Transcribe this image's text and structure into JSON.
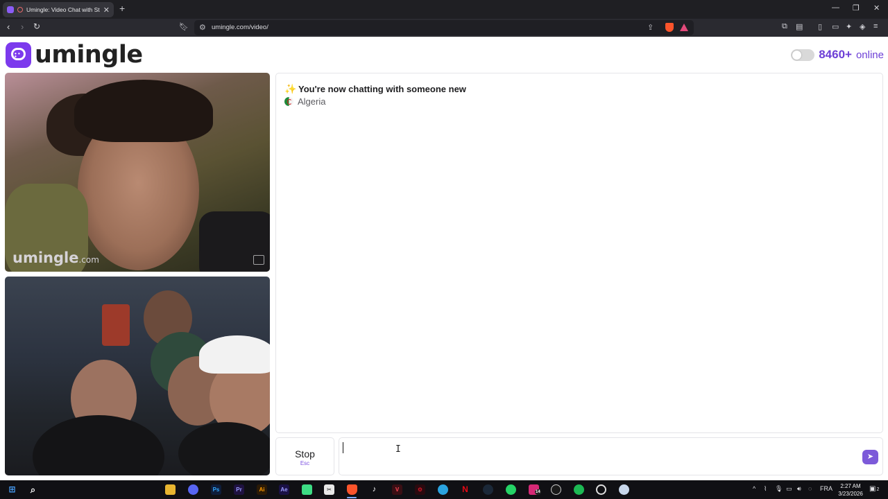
{
  "browser": {
    "tab_title": "Umingle: Video Chat with Str",
    "new_tab": "+",
    "url": "umingle.com/video/",
    "window_controls": [
      "—",
      "❐",
      "✕"
    ]
  },
  "header": {
    "logo_text": "umingle",
    "online_count": "8460+",
    "online_label": "online"
  },
  "videos": {
    "watermark_main": "umingle",
    "watermark_suffix": ".com"
  },
  "chat": {
    "system_message": "You're now chatting with someone new",
    "country": "Algeria",
    "stop_label": "Stop",
    "stop_key": "Esc",
    "input_value": ""
  },
  "taskbar": {
    "language": "FRA",
    "time": "2:27 AM",
    "date": "3/23/2026",
    "notification_count": "2",
    "badge_count": "14",
    "apps": [
      "file-explorer",
      "discord",
      "photoshop",
      "premiere",
      "illustrator",
      "after-effects",
      "android-studio",
      "capcut",
      "brave",
      "tiktok",
      "valorant",
      "opera-gx",
      "telegram",
      "netflix",
      "steam",
      "whatsapp",
      "instagram",
      "osu",
      "spotify",
      "obs",
      "browser-alt"
    ]
  },
  "colors": {
    "accent": "#6d3fd6",
    "brand": "#7c3aed"
  }
}
